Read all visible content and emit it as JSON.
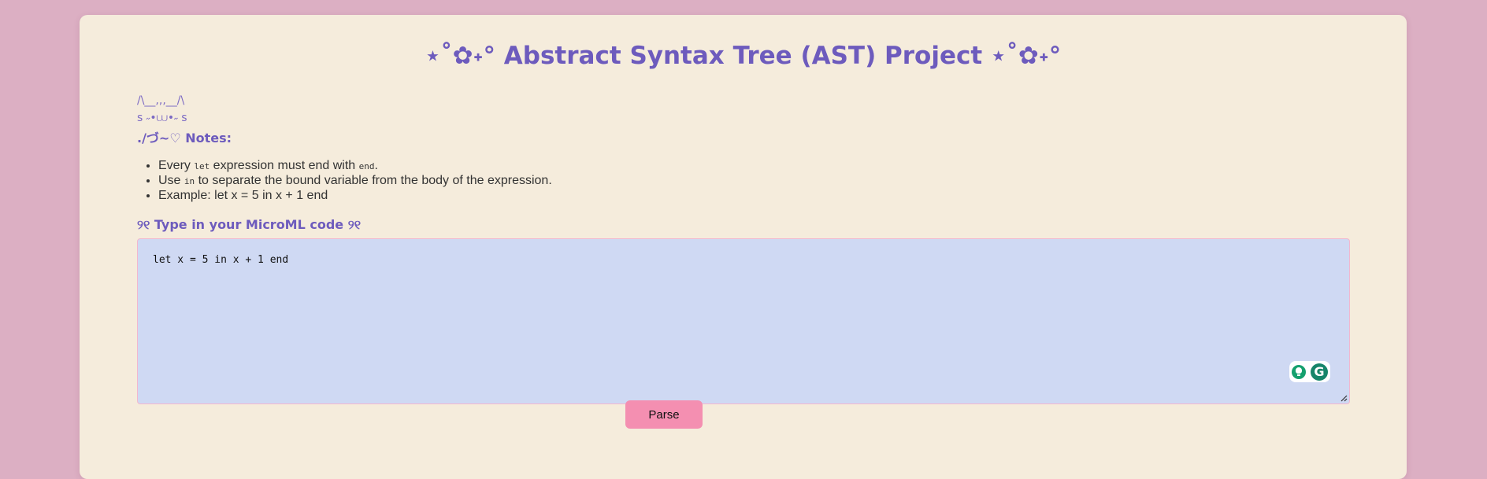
{
  "page": {
    "title": "⋆˚✿˖° Abstract Syntax Tree (AST) Project ⋆˚✿˖°"
  },
  "kaomoji": {
    "line1": "/\\__,,,__/\\",
    "line2": "ꜱ ˶•⩊•˶ ꜱ"
  },
  "notes": {
    "heading": "./づ~♡ Notes:",
    "items": [
      {
        "pre": "Every ",
        "code": "let",
        "post": " expression must end with ",
        "code2": "end",
        "post2": "."
      },
      {
        "pre": "Use ",
        "code": "in",
        "post": " to separate the bound variable from the body of the expression."
      },
      {
        "text": "Example: let x = 5 in x + 1 end"
      }
    ]
  },
  "editor": {
    "label": "୨୧ Type in your MicroML code ୨୧",
    "value": "let x = 5 in x + 1 end"
  },
  "assistant": {
    "bulb_icon": "lightbulb-icon",
    "grammarly_icon": "grammarly-icon",
    "grammarly_letter": "G"
  },
  "actions": {
    "parse_label": "Parse"
  },
  "colors": {
    "background": "#dcafc3",
    "card": "#f5ecdc",
    "accent": "#6d5bbd",
    "editor_bg": "#cfd9f3",
    "button": "#f48fb1"
  }
}
